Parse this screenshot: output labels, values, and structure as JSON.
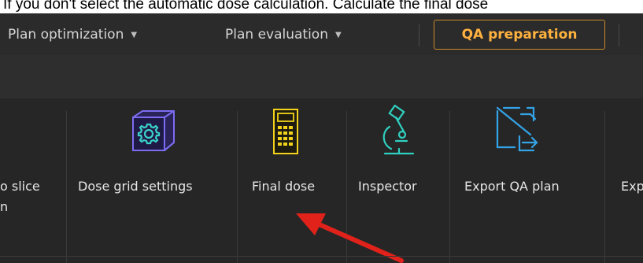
{
  "caption": "If you don't select the automatic dose calculation. Calculate the final dose",
  "tabs": [
    {
      "label": "Plan optimization",
      "caret": "▼"
    },
    {
      "label": "Plan evaluation",
      "caret": "▼"
    },
    {
      "label": "QA preparation"
    }
  ],
  "ribbon": {
    "items": [
      {
        "label_line1": "o slice",
        "label_line2": "n"
      },
      {
        "label": "Dose grid settings",
        "icon": "gear-cube-icon"
      },
      {
        "label": "Final dose",
        "icon": "calculator-icon"
      },
      {
        "label": "Inspector",
        "icon": "microscope-icon"
      },
      {
        "label": "Export QA plan",
        "icon": "export-plan-icon"
      },
      {
        "label": "Exp"
      }
    ]
  },
  "colors": {
    "accent": "#ffb23e",
    "qa_border": "#c98a2c",
    "arrow": "#e0221b",
    "gear_cube": "#7b6cf2",
    "gear": "#3ad3c8",
    "calculator": "#f2d21a",
    "microscope": "#2fd0c0",
    "export": "#33a4e8"
  }
}
